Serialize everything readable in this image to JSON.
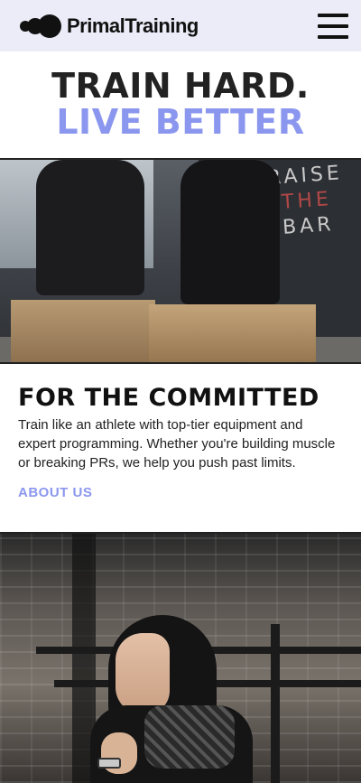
{
  "brand": {
    "name": "PrimalTraining",
    "logo_icon": "three-circles-logo-icon"
  },
  "nav": {
    "menu_icon": "hamburger-menu-icon"
  },
  "hero": {
    "line1": "TRAIN HARD.",
    "line2": "LIVE BETTER"
  },
  "section": {
    "heading": "FOR THE COMMITTED",
    "body": "Train like an athlete with top-tier equipment and expert programming. Whether you're building muscle or breaking PRs, we help you push past limits.",
    "link_label": "ABOUT US"
  },
  "photo1": {
    "wall_text_line1": "RAISE",
    "wall_text_line2": "THE",
    "wall_text_line3": "BAR"
  },
  "colors": {
    "accent": "#8b97ee",
    "header_bg": "#ececf8",
    "text": "#111111"
  }
}
